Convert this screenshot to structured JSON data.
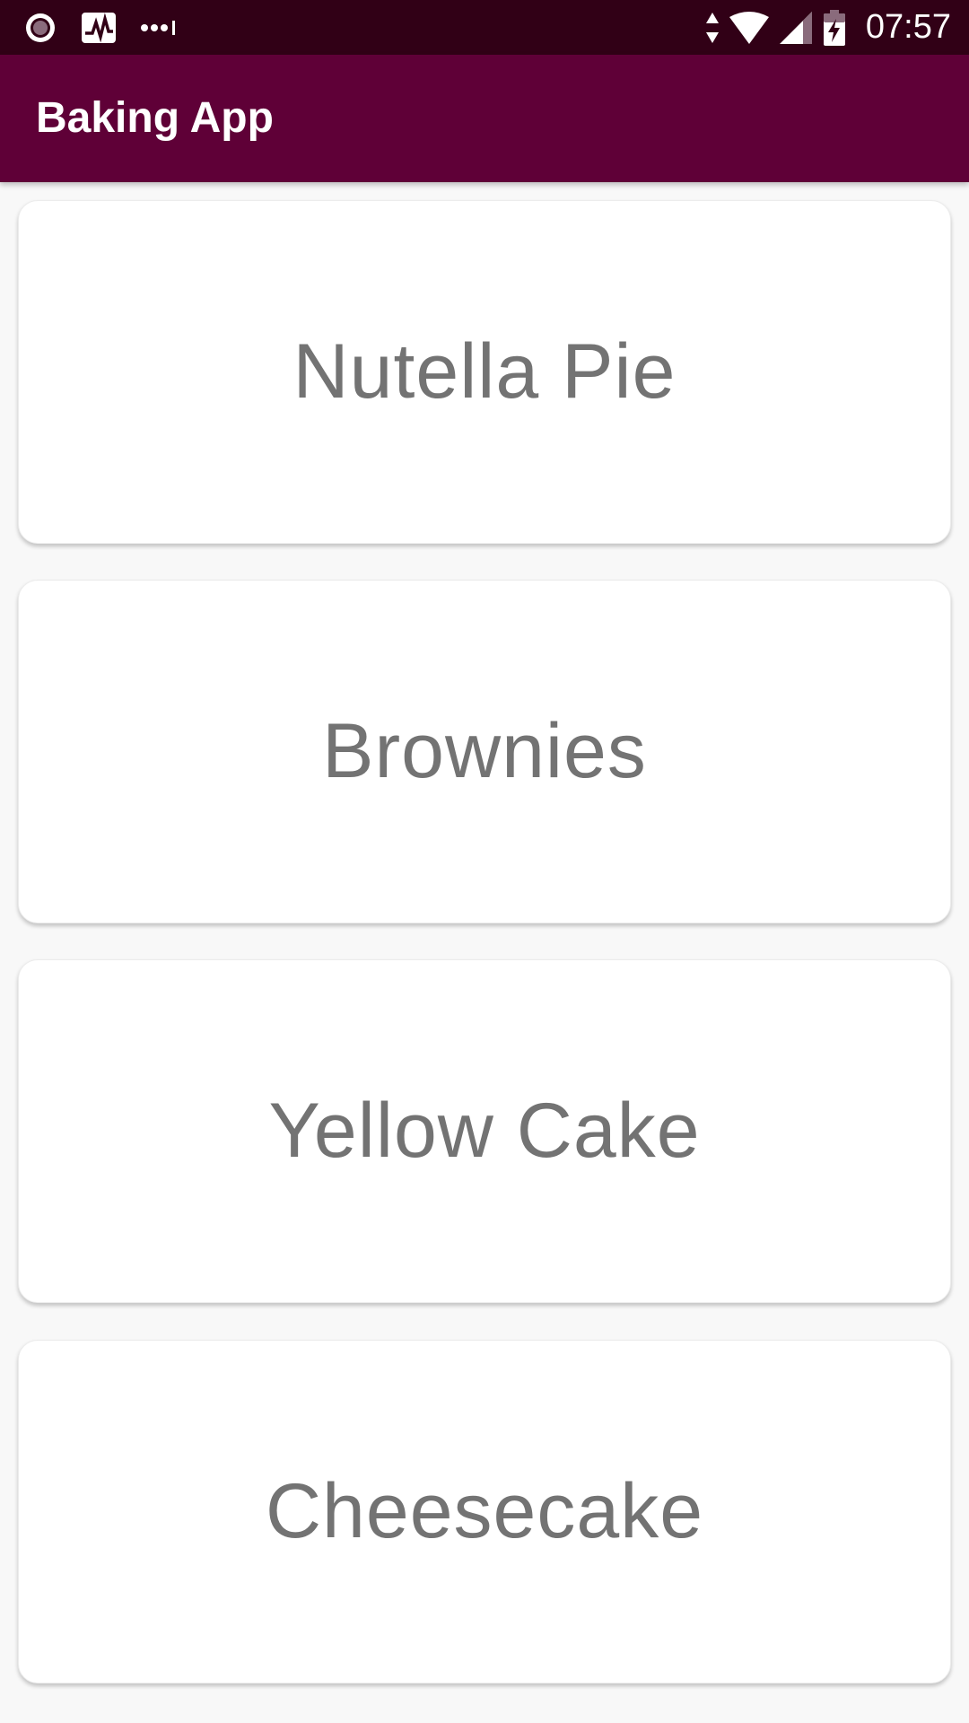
{
  "status_bar": {
    "time": "07:57",
    "left_icons": [
      "record-icon",
      "activity-monitor-icon",
      "more-dots-icon"
    ],
    "right_icons": [
      "data-arrows-icon",
      "wifi-icon",
      "cell-signal-icon",
      "battery-charging-icon"
    ],
    "background_color": "#310016"
  },
  "app_bar": {
    "title": "Baking App",
    "background_color": "#5f0037"
  },
  "recipes": [
    {
      "name": "Nutella Pie"
    },
    {
      "name": "Brownies"
    },
    {
      "name": "Yellow Cake"
    },
    {
      "name": "Cheesecake"
    }
  ],
  "colors": {
    "card_text": "#737373",
    "list_background": "#f8f8f8"
  }
}
